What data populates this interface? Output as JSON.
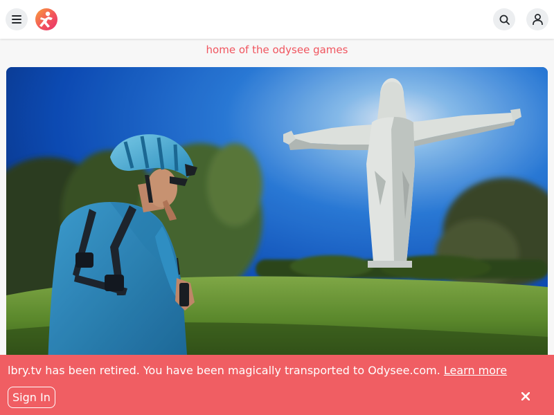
{
  "header": {
    "menu_icon": "hamburger-menu-icon",
    "logo_icon": "odysee-logo",
    "search_icon": "search-icon",
    "user_icon": "user-icon"
  },
  "tagline": "home of the odysee games",
  "hero": {
    "image_subject": "cyclist in blue helmet operating a drone controller in front of a large white statue with outstretched arms under a blue sky"
  },
  "banner": {
    "message": "lbry.tv has been retired. You have been magically transported to Odysee.com.",
    "learn_more_label": "Learn more",
    "sign_in_label": "Sign In",
    "close_icon": "close-icon"
  },
  "colors": {
    "accent": "#f0555f",
    "banner_bg": "#f05e63",
    "header_bg": "#ffffff",
    "icon_button_bg": "#eceef0"
  }
}
